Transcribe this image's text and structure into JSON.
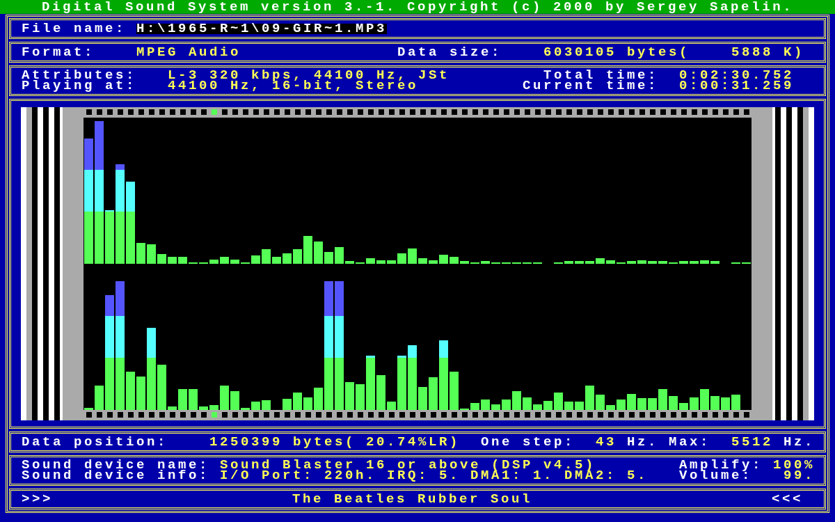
{
  "title": "Digital Sound System version 3.-1. Copyright (c) 2000 by Sergey Sapelin.",
  "file_name": {
    "label": "File name:",
    "value": "H:\\1965-R~1\\09-GIR~1.MP3"
  },
  "format": {
    "label": "Format:",
    "value": "MPEG Audio"
  },
  "data_size": {
    "label": "Data size:",
    "value": "6030105 bytes(    5888 K)"
  },
  "attributes": {
    "label": "Attributes:",
    "value": "L-3 320 kbps, 44100 Hz, JSt"
  },
  "total_time": {
    "label": "Total time:",
    "value": "0:02:30.752"
  },
  "playing_at": {
    "label": "Playing at:",
    "value": "44100 Hz, 16-bit, Stereo"
  },
  "current_time": {
    "label": "Current time:",
    "value": "0:00:31.259"
  },
  "data_position": {
    "label": "Data position:",
    "value": "1250399 bytes( 20.74%LR)"
  },
  "one_step": {
    "label": "One step:",
    "value": "43",
    "unit": "Hz."
  },
  "max": {
    "label": "Max:",
    "value": "5512",
    "unit": "Hz."
  },
  "sound_device_name": {
    "label": "Sound device name:",
    "value": "Sound Blaster 16 or above (DSP v4.5)"
  },
  "amplify": {
    "label": "Amplify:",
    "value": "100%"
  },
  "sound_device_info": {
    "label": "Sound device info:",
    "value": "I/O Port: 220h. IRQ: 5. DMA1: 1. DMA2: 5."
  },
  "volume": {
    "label": "Volume:",
    "value": "99."
  },
  "marquee": {
    "left": ">>>",
    "text": "The Beatles Rubber Soul",
    "right": "<<<"
  }
}
